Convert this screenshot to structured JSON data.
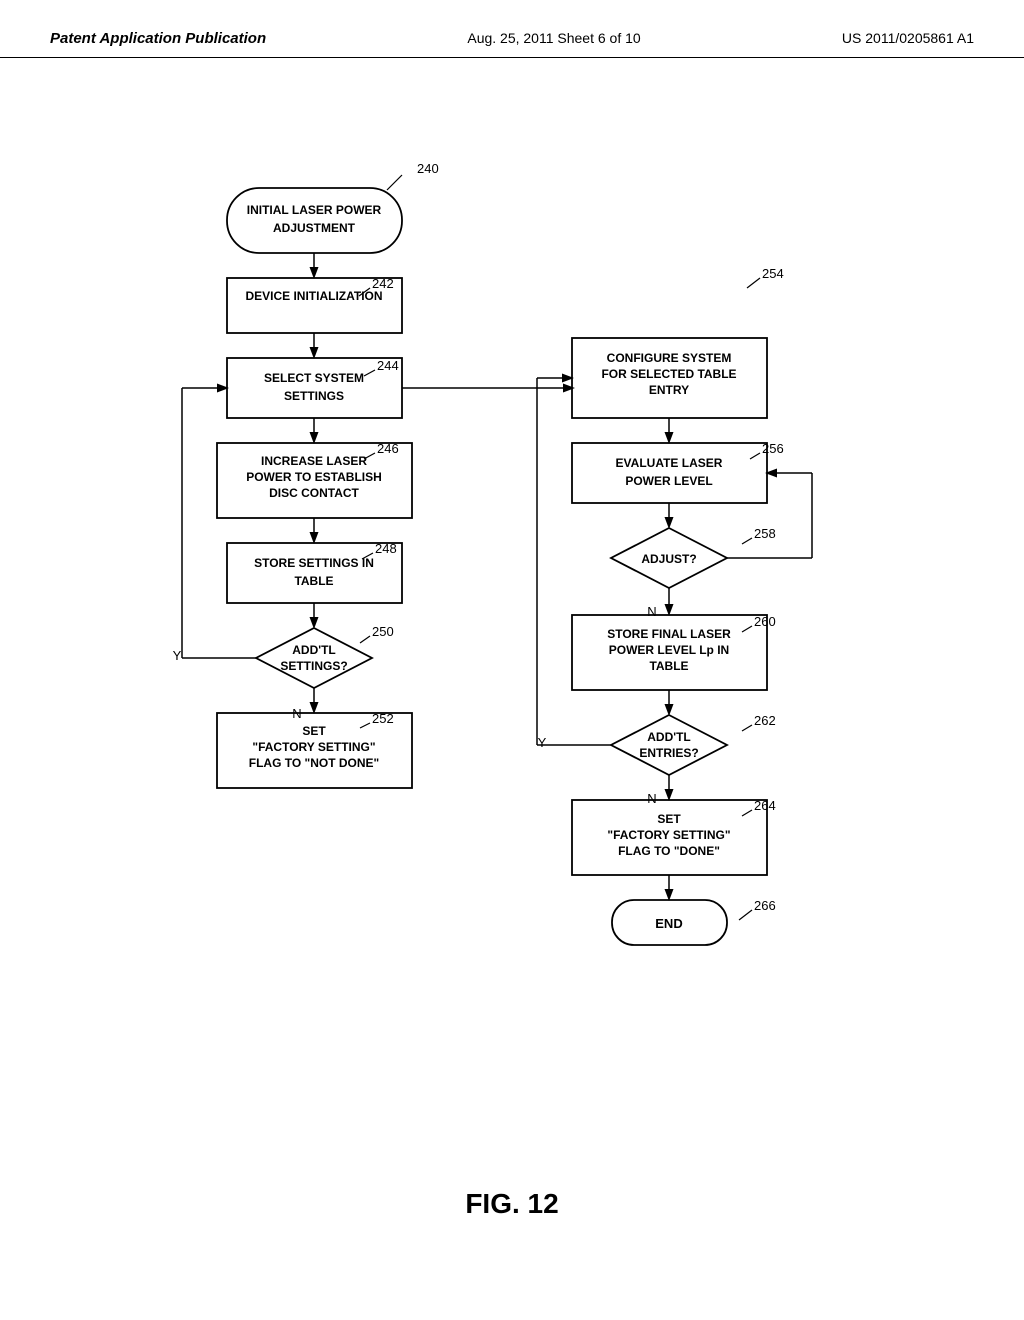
{
  "header": {
    "left_label": "Patent Application Publication",
    "center_label": "Aug. 25, 2011  Sheet 6 of 10",
    "right_label": "US 2011/0205861 A1"
  },
  "fig_label": "FIG. 12",
  "nodes": {
    "n240": {
      "label": "INITIAL LASER POWER\nADJUSTMENT",
      "ref": "240"
    },
    "n242": {
      "label": "DEVICE INITIALIZATION",
      "ref": "242"
    },
    "n244": {
      "label": "SELECT SYSTEM\nSETTINGS",
      "ref": "244"
    },
    "n246": {
      "label": "INCREASE LASER\nPOWER TO ESTABLISH\nDISC CONTACT",
      "ref": "246"
    },
    "n248": {
      "label": "STORE SETTINGS IN\nTABLE",
      "ref": "248"
    },
    "n250": {
      "label": "ADD'TL\nSETTINGS?",
      "ref": "250"
    },
    "n252": {
      "label": "SET\n\"FACTORY SETTING\"\nFLAG TO \"NOT DONE\"",
      "ref": "252"
    },
    "n254": {
      "label": "CONFIGURE SYSTEM\nFOR SELECTED TABLE\nENTRY",
      "ref": "254"
    },
    "n256": {
      "label": "EVALUATE LASER\nPOWER LEVEL",
      "ref": "256"
    },
    "n258": {
      "label": "ADJUST?",
      "ref": "258"
    },
    "n260": {
      "label": "STORE FINAL LASER\nPOWER LEVEL Lp IN\nTABLE",
      "ref": "260"
    },
    "n262": {
      "label": "ADD'TL\nENTRIES?",
      "ref": "262"
    },
    "n264": {
      "label": "SET\n\"FACTORY SETTING\"\nFLAG TO \"DONE\"",
      "ref": "264"
    },
    "n266": {
      "label": "END",
      "ref": "266"
    }
  }
}
